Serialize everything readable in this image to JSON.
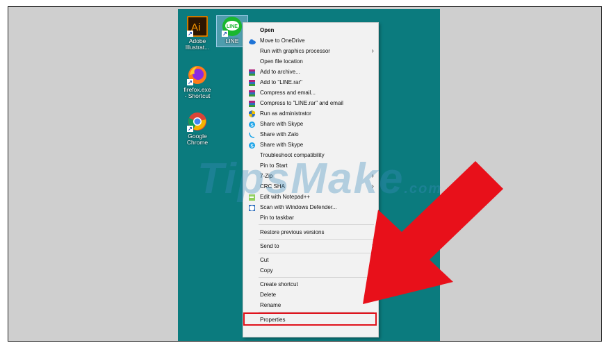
{
  "desktop": {
    "icons": [
      {
        "label": "Adobe Illustrat...",
        "name": "illustrator-icon"
      },
      {
        "label": "LINE",
        "name": "line-icon"
      },
      {
        "label": "firefox.exe - Shortcut",
        "name": "firefox-icon"
      },
      {
        "label": "Google Chrome",
        "name": "chrome-icon"
      }
    ]
  },
  "menu": {
    "items": [
      {
        "label": "Open",
        "icon": ""
      },
      {
        "label": "Move to OneDrive",
        "icon": "onedrive-icon"
      },
      {
        "label": "Run with graphics processor",
        "icon": "",
        "submenu": true
      },
      {
        "label": "Open file location",
        "icon": ""
      },
      {
        "label": "Add to archive...",
        "icon": "winrar-icon"
      },
      {
        "label": "Add to \"LINE.rar\"",
        "icon": "winrar-icon"
      },
      {
        "label": "Compress and email...",
        "icon": "winrar-icon"
      },
      {
        "label": "Compress to \"LINE.rar\" and email",
        "icon": "winrar-icon"
      },
      {
        "label": "Run as administrator",
        "icon": "shield-icon"
      },
      {
        "label": "Share with Skype",
        "icon": "skype-icon"
      },
      {
        "label": "Share with Zalo",
        "icon": "zalo-icon"
      },
      {
        "label": "Share with Skype",
        "icon": "skype-icon"
      },
      {
        "label": "Troubleshoot compatibility",
        "icon": ""
      },
      {
        "label": "Pin to Start",
        "icon": ""
      },
      {
        "label": "7-Zip",
        "icon": "",
        "submenu": true
      },
      {
        "label": "CRC SHA",
        "icon": "",
        "submenu": true
      },
      {
        "label": "Edit with Notepad++",
        "icon": "notepad-icon"
      },
      {
        "label": "Scan with Windows Defender...",
        "icon": "defender-icon"
      },
      {
        "label": "Pin to taskbar",
        "icon": ""
      },
      {
        "label": "Restore previous versions",
        "icon": ""
      },
      {
        "label": "Send to",
        "icon": "",
        "submenu": true
      },
      {
        "label": "Cut",
        "icon": ""
      },
      {
        "label": "Copy",
        "icon": ""
      },
      {
        "label": "Create shortcut",
        "icon": ""
      },
      {
        "label": "Delete",
        "icon": ""
      },
      {
        "label": "Rename",
        "icon": ""
      },
      {
        "label": "Properties",
        "icon": ""
      }
    ]
  },
  "watermark": {
    "main": "TipsMake",
    "suffix": ".com"
  },
  "colors": {
    "desktop": "#0b7b7e",
    "arrow": "#e8101a",
    "highlight": "#e0101a"
  }
}
